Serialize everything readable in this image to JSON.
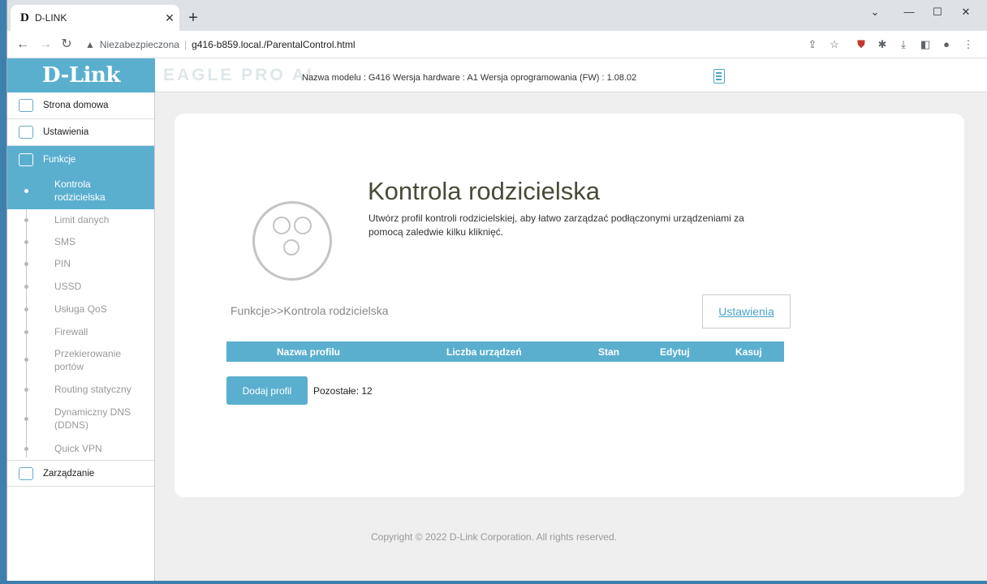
{
  "browser": {
    "tab_title": "D-LINK",
    "tab_favicon": "D",
    "security_label": "Niezabezpieczona",
    "url": "g416-b859.local./ParentalControl.html"
  },
  "header": {
    "logo": "D-Link",
    "eagle": "EAGLE PRO AI",
    "model_info": "Nazwa modelu : G416 Wersja hardware : A1 Wersja oprogramowania (FW) : 1.08.02"
  },
  "sidebar": {
    "home": "Strona domowa",
    "settings": "Ustawienia",
    "features": "Funkcje",
    "management": "Zarządzanie",
    "sub_items": [
      {
        "label": "Kontrola rodzicielska"
      },
      {
        "label": "Limit danych"
      },
      {
        "label": "SMS"
      },
      {
        "label": "PIN"
      },
      {
        "label": "USSD"
      },
      {
        "label": "Usługa QoS"
      },
      {
        "label": "Firewall"
      },
      {
        "label": "Przekierowanie portów"
      },
      {
        "label": "Routing statyczny"
      },
      {
        "label": "Dynamiczny DNS (DDNS)"
      },
      {
        "label": "Quick VPN"
      }
    ]
  },
  "main": {
    "title": "Kontrola rodzicielska",
    "description": "Utwórz profil kontroli rodzicielskiej, aby łatwo zarządzać podłączonymi urządzeniami za pomocą zaledwie kilku kliknięć.",
    "breadcrumb": "Funkcje>>Kontrola rodzicielska",
    "settings_button": "Ustawienia",
    "table_headers": [
      "Nazwa profilu",
      "Liczba urządzeń",
      "Stan",
      "Edytuj",
      "Kasuj"
    ],
    "add_button": "Dodaj profil",
    "remaining": "Pozostałe: 12"
  },
  "footer": {
    "copyright": "Copyright © 2022 D-Link Corporation. All rights reserved."
  }
}
